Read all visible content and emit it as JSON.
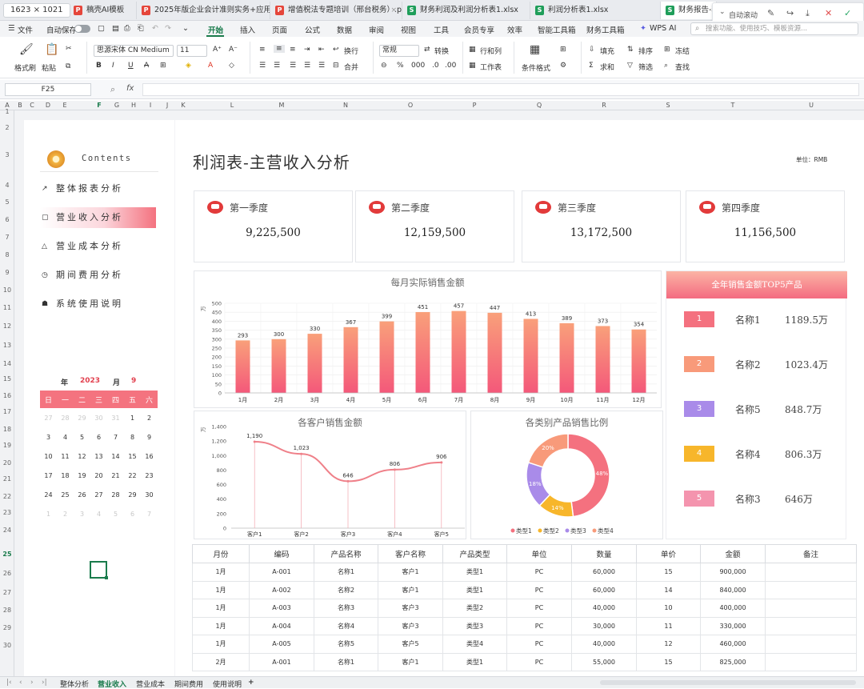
{
  "screen_dims": "1623 × 1021",
  "file_tabs": [
    {
      "label": "稿壳AI模板",
      "kind": "pdf",
      "active": false
    },
    {
      "label": "2025年版企业会计准则实务+应用指",
      "kind": "pdf",
      "active": false
    },
    {
      "label": "增值税法专题培训（邢台税务）.pdf",
      "kind": "pdf",
      "active": false
    },
    {
      "label": "财务利润及利润分析表1.xlsx",
      "kind": "xls",
      "active": false
    },
    {
      "label": "利润分析表1.xlsx",
      "kind": "xls",
      "active": false
    },
    {
      "label": "财务报告-利",
      "kind": "xls",
      "active": true
    }
  ],
  "tab_tools": {
    "auto_scroll": "自动滚动"
  },
  "menu": {
    "file": "文件",
    "autosave": "自动保存",
    "items": [
      "开始",
      "插入",
      "页面",
      "公式",
      "数据",
      "审阅",
      "视图",
      "工具",
      "会员专享",
      "效率",
      "智能工具箱",
      "财务工具箱"
    ],
    "wps_ai": "WPS AI",
    "search_placeholder": "搜索功能、使用技巧、模板资源..."
  },
  "ribbon": {
    "format_painter": "格式刷",
    "paste": "粘贴",
    "font_name": "思源宋体 CN Medium",
    "font_size": "11",
    "wrap": "换行",
    "merge": "合并",
    "number_format": "常规",
    "convert": "转换",
    "rows_cols": "行和列",
    "worksheet": "工作表",
    "cond_format": "条件格式",
    "fill": "填充",
    "sort": "排序",
    "freeze": "冻结",
    "sum": "求和",
    "filter": "筛选",
    "find": "查找"
  },
  "formula_bar": {
    "cell_ref": "F25",
    "fx": "fx"
  },
  "columns": [
    "A",
    "B",
    "C",
    "D",
    "E",
    "F",
    "G",
    "H",
    "I",
    "J",
    "K",
    "L",
    "M",
    "N",
    "O",
    "P",
    "Q",
    "R",
    "S",
    "T",
    "U"
  ],
  "rows": [
    "1",
    "2",
    "3",
    "4",
    "5",
    "6",
    "7",
    "8",
    "9",
    "10",
    "11",
    "12",
    "13",
    "14",
    "15",
    "16",
    "17",
    "18",
    "19",
    "20",
    "21",
    "22",
    "23",
    "24",
    "25",
    "26",
    "27",
    "28",
    "29",
    "30"
  ],
  "sidebar": {
    "contents_title": "Contents",
    "items": [
      {
        "label": "整体报表分析",
        "icon": "chart-line-icon"
      },
      {
        "label": "营业收入分析",
        "icon": "square-icon"
      },
      {
        "label": "营业成本分析",
        "icon": "triangle-icon"
      },
      {
        "label": "期间费用分析",
        "icon": "clock-icon"
      },
      {
        "label": "系统使用说明",
        "icon": "users-icon"
      }
    ]
  },
  "calendar": {
    "year_label": "年",
    "year": "2023",
    "month_label": "月",
    "month": "9",
    "weekdays": [
      "日",
      "一",
      "二",
      "三",
      "四",
      "五",
      "六"
    ],
    "weeks": [
      [
        "27",
        "28",
        "29",
        "30",
        "31",
        "1",
        "2"
      ],
      [
        "3",
        "4",
        "5",
        "6",
        "7",
        "8",
        "9"
      ],
      [
        "10",
        "11",
        "12",
        "13",
        "14",
        "15",
        "16"
      ],
      [
        "17",
        "18",
        "19",
        "20",
        "21",
        "22",
        "23"
      ],
      [
        "24",
        "25",
        "26",
        "27",
        "28",
        "29",
        "30"
      ],
      [
        "1",
        "2",
        "3",
        "4",
        "5",
        "6",
        "7"
      ]
    ]
  },
  "dashboard": {
    "title": "利润表-主营收入分析",
    "unit": "单位：RMB",
    "quarters": [
      {
        "name": "第一季度",
        "value": "9,225,500"
      },
      {
        "name": "第二季度",
        "value": "12,159,500"
      },
      {
        "name": "第三季度",
        "value": "13,172,500"
      },
      {
        "name": "第四季度",
        "value": "11,156,500"
      }
    ],
    "top5": {
      "title": "全年销售金额TOP5产品",
      "items": [
        {
          "rank": "1",
          "name": "名称1",
          "value": "1189.5万",
          "color": "#f4717f"
        },
        {
          "rank": "2",
          "name": "名称2",
          "value": "1023.4万",
          "color": "#f89a7a"
        },
        {
          "rank": "3",
          "name": "名称5",
          "value": "848.7万",
          "color": "#a98be9"
        },
        {
          "rank": "4",
          "name": "名称4",
          "value": "806.3万",
          "color": "#f7b62b"
        },
        {
          "rank": "5",
          "name": "名称3",
          "value": "646万",
          "color": "#f494ae"
        }
      ]
    }
  },
  "table": {
    "headers": [
      "月份",
      "编码",
      "产品名称",
      "客户名称",
      "产品类型",
      "单位",
      "数量",
      "单价",
      "金额",
      "备注"
    ],
    "rows": [
      [
        "1月",
        "A-001",
        "名称1",
        "客户1",
        "类型1",
        "PC",
        "60,000",
        "15",
        "900,000",
        ""
      ],
      [
        "1月",
        "A-002",
        "名称2",
        "客户1",
        "类型1",
        "PC",
        "60,000",
        "14",
        "840,000",
        ""
      ],
      [
        "1月",
        "A-003",
        "名称3",
        "客户3",
        "类型2",
        "PC",
        "40,000",
        "10",
        "400,000",
        ""
      ],
      [
        "1月",
        "A-004",
        "名称4",
        "客户3",
        "类型3",
        "PC",
        "30,000",
        "11",
        "330,000",
        ""
      ],
      [
        "1月",
        "A-005",
        "名称5",
        "客户5",
        "类型4",
        "PC",
        "40,000",
        "12",
        "460,000",
        ""
      ],
      [
        "2月",
        "A-001",
        "名称1",
        "客户1",
        "类型1",
        "PC",
        "55,000",
        "15",
        "825,000",
        ""
      ]
    ]
  },
  "sheet_tabs": [
    {
      "label": "整体分析",
      "active": false
    },
    {
      "label": "营业收入",
      "active": true
    },
    {
      "label": "营业成本",
      "active": false
    },
    {
      "label": "期间费用",
      "active": false
    },
    {
      "label": "使用说明",
      "active": false
    }
  ],
  "colors": {
    "accent": "#1a7b4c",
    "brand_pink": "#f4727f",
    "bar_top": "#f9a07a",
    "bar_bottom": "#f4587a"
  },
  "chart_data": [
    {
      "type": "bar",
      "title": "每月实际销售金额",
      "ylabel": "万",
      "categories": [
        "1月",
        "2月",
        "3月",
        "4月",
        "5月",
        "6月",
        "7月",
        "8月",
        "9月",
        "10月",
        "11月",
        "12月"
      ],
      "values": [
        293,
        300,
        330,
        367,
        399,
        451,
        457,
        447,
        413,
        389,
        373,
        354
      ],
      "ylim": [
        0,
        500
      ],
      "yticks": [
        0,
        50,
        100,
        150,
        200,
        250,
        300,
        350,
        400,
        450,
        500
      ],
      "grid": true
    },
    {
      "type": "line",
      "title": "各客户销售金额",
      "ylabel": "万",
      "categories": [
        "客户1",
        "客户2",
        "客户3",
        "客户4",
        "客户5"
      ],
      "values": [
        1190,
        1023,
        646,
        806,
        906
      ],
      "value_labels": [
        "1,190",
        "1,023",
        "646",
        "806",
        "906"
      ],
      "ylim": [
        0,
        1400
      ],
      "yticks": [
        0,
        200,
        400,
        600,
        800,
        1000,
        1200,
        1400
      ],
      "ytick_labels": [
        "0",
        "200",
        "400",
        "600",
        "800",
        "1,000",
        "1,200",
        "1,400"
      ],
      "grid": false
    },
    {
      "type": "pie",
      "title": "各类别产品销售比例",
      "categories": [
        "类型1",
        "类型2",
        "类型3",
        "类型4"
      ],
      "values": [
        48,
        14,
        18,
        20
      ],
      "value_labels": [
        "48%",
        "14%",
        "18%",
        "20%"
      ],
      "colors": [
        "#f4717f",
        "#f7b62b",
        "#a98be9",
        "#f89a7a"
      ],
      "legend": "bottom"
    }
  ]
}
